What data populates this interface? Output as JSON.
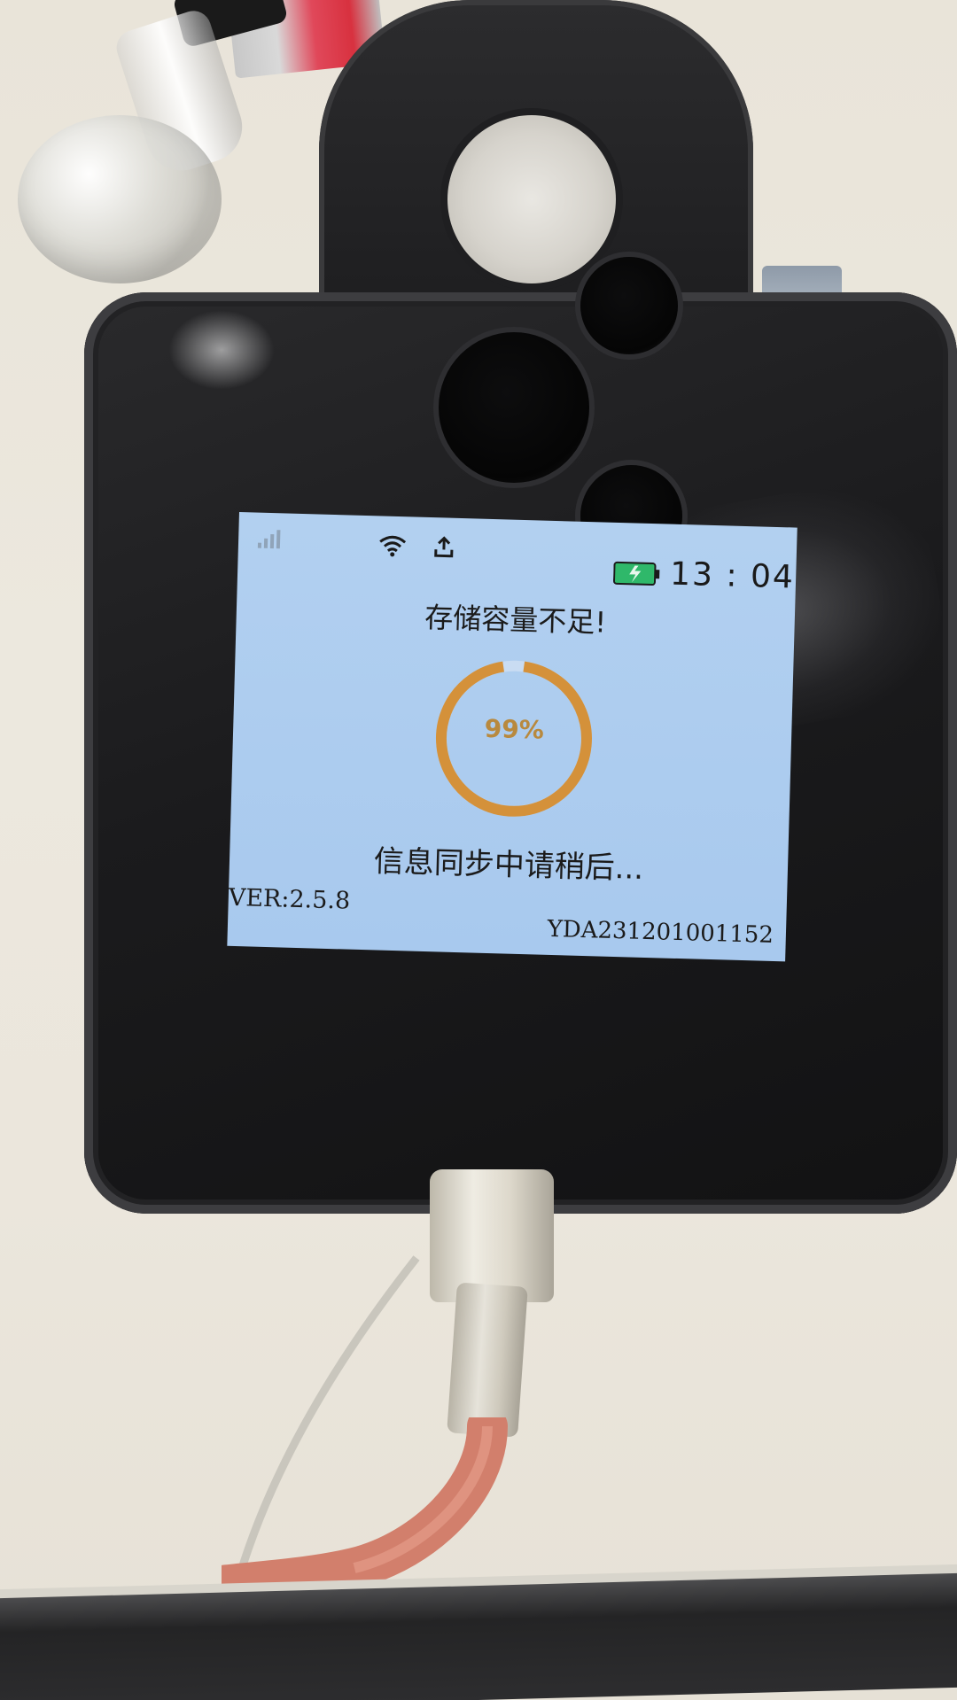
{
  "screen": {
    "status": {
      "signal_icon": "signal-bars-icon",
      "wifi_icon": "wifi-icon",
      "upload_icon": "upload-icon",
      "battery_icon": "battery-charging-icon",
      "time": "13 : 04"
    },
    "headline": "存储容量不足!",
    "progress": {
      "label": "99%",
      "fraction": 0.99,
      "color": "#d4913a"
    },
    "sync_message": "信息同步中请稍后...",
    "version": "VER:2.5.8",
    "serial": "YDA231201001152",
    "background_color": "#aacbef"
  }
}
